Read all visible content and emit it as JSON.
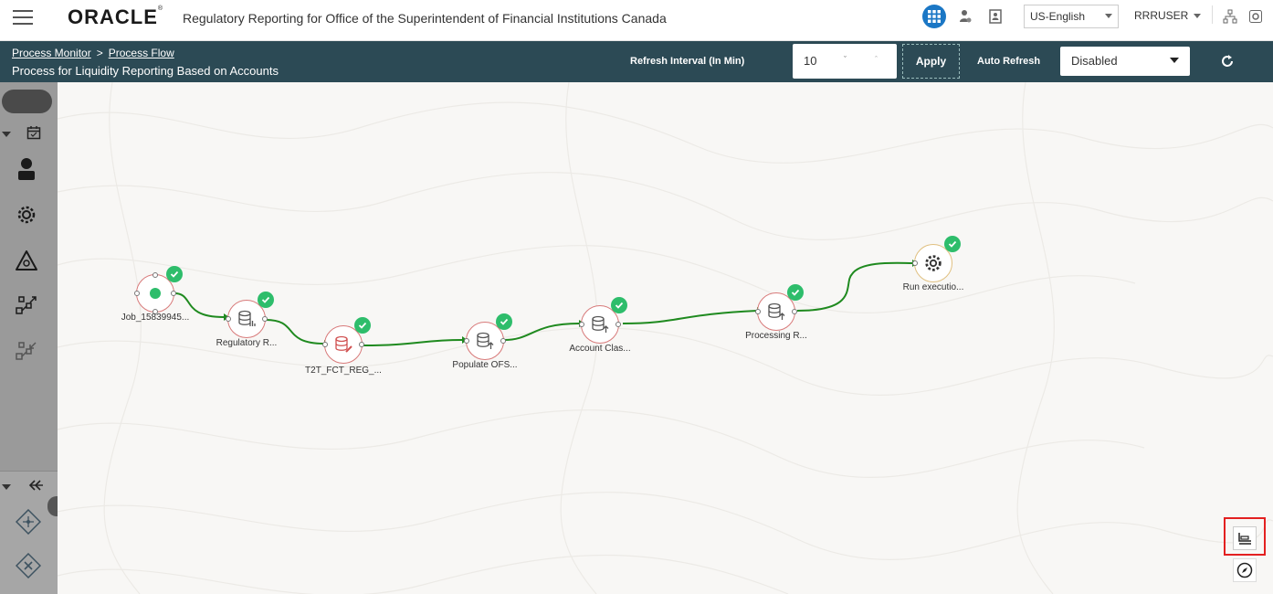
{
  "topbar": {
    "logo": "ORACLE",
    "app_title": "Regulatory Reporting for Office of the Superintendent of Financial Institutions Canada",
    "language": "US-English",
    "user": "RRRUSER"
  },
  "header": {
    "breadcrumb": [
      "Process Monitor",
      "Process Flow"
    ],
    "breadcrumb_separator": ">",
    "title": "Process for Liquidity Reporting Based on Accounts",
    "refresh_interval_label": "Refresh Interval (In Min)",
    "refresh_interval_value": "10",
    "apply_label": "Apply",
    "auto_refresh_label": "Auto Refresh",
    "auto_refresh_value": "Disabled"
  },
  "flow": {
    "nodes": [
      {
        "label": "Job_15839945...",
        "type": "start",
        "status": "success"
      },
      {
        "label": "Regulatory R...",
        "type": "data-report",
        "status": "success"
      },
      {
        "label": "T2T_FCT_REG_...",
        "type": "data-edit",
        "status": "success"
      },
      {
        "label": "Populate OFS...",
        "type": "data-load",
        "status": "success"
      },
      {
        "label": "Account Clas...",
        "type": "data-load",
        "status": "success"
      },
      {
        "label": "Processing R...",
        "type": "data-load",
        "status": "success"
      },
      {
        "label": "Run executio...",
        "type": "run",
        "status": "success"
      }
    ]
  },
  "colors": {
    "header_band": "#2c4a55",
    "accent_blue": "#1b77c5",
    "success_green": "#2ebd6b",
    "edge_green": "#1f8a1f",
    "node_border": "#d87a7a",
    "highlight_red": "#e32020"
  }
}
